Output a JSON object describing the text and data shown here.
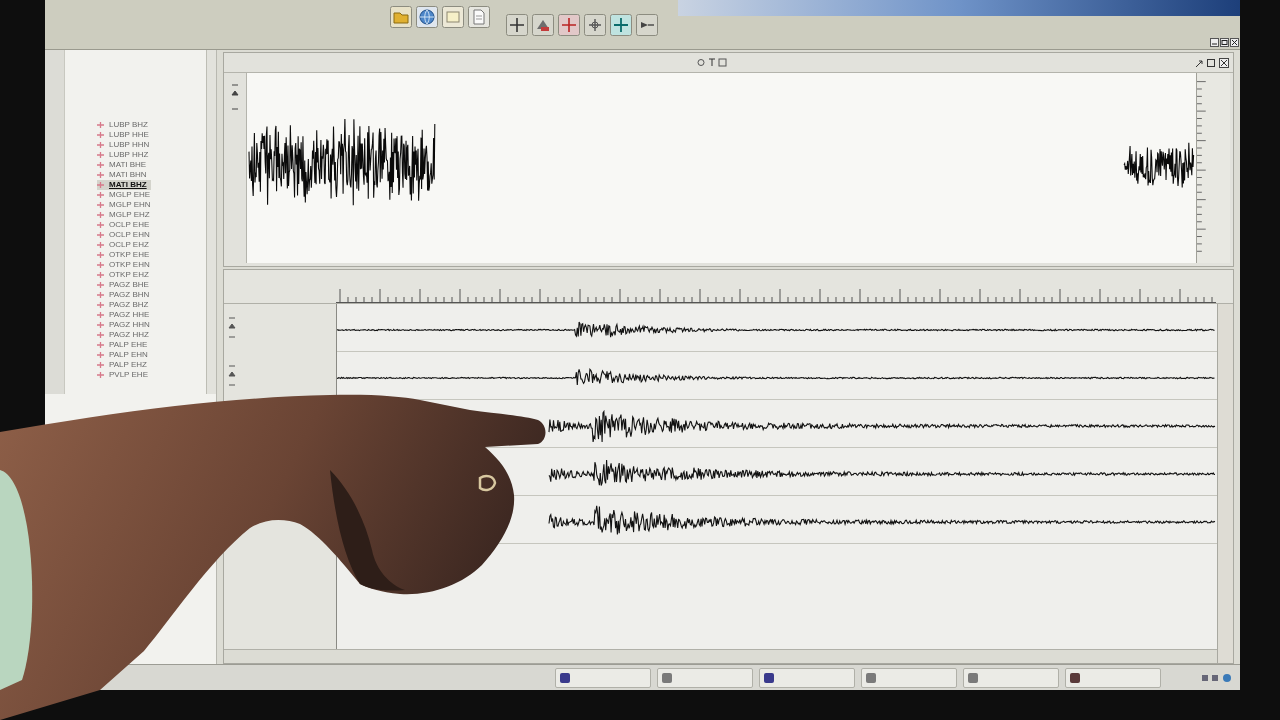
{
  "station_list": {
    "items": [
      {
        "label": "LUBP BHZ",
        "selected": false
      },
      {
        "label": "LUBP HHE",
        "selected": false
      },
      {
        "label": "LUBP HHN",
        "selected": false
      },
      {
        "label": "LUBP HHZ",
        "selected": false
      },
      {
        "label": "MATI BHE",
        "selected": false
      },
      {
        "label": "MATI BHN",
        "selected": false
      },
      {
        "label": "MATI BHZ",
        "selected": true
      },
      {
        "label": "MGLP EHE",
        "selected": false
      },
      {
        "label": "MGLP EHN",
        "selected": false
      },
      {
        "label": "MGLP EHZ",
        "selected": false
      },
      {
        "label": "OCLP EHE",
        "selected": false
      },
      {
        "label": "OCLP EHN",
        "selected": false
      },
      {
        "label": "OCLP EHZ",
        "selected": false
      },
      {
        "label": "OTKP EHE",
        "selected": false
      },
      {
        "label": "OTKP EHN",
        "selected": false
      },
      {
        "label": "OTKP EHZ",
        "selected": false
      },
      {
        "label": "PAGZ BHE",
        "selected": false
      },
      {
        "label": "PAGZ BHN",
        "selected": false
      },
      {
        "label": "PAGZ BHZ",
        "selected": false
      },
      {
        "label": "PAGZ HHE",
        "selected": false
      },
      {
        "label": "PAGZ HHN",
        "selected": false
      },
      {
        "label": "PAGZ HHZ",
        "selected": false
      },
      {
        "label": "PALP EHE",
        "selected": false
      },
      {
        "label": "PALP EHN",
        "selected": false
      },
      {
        "label": "PALP EHZ",
        "selected": false
      },
      {
        "label": "PVLP EHE",
        "selected": false
      }
    ]
  },
  "traces": [
    {
      "kind": "weak"
    },
    {
      "kind": "weak"
    },
    {
      "kind": "strong"
    },
    {
      "kind": "strong"
    },
    {
      "kind": "strong"
    }
  ]
}
